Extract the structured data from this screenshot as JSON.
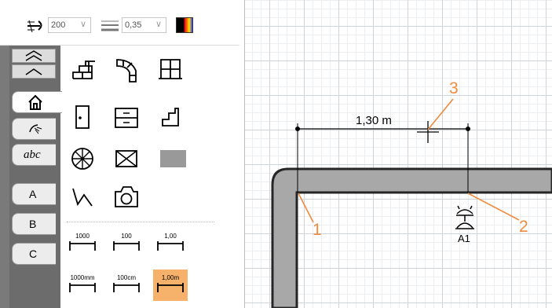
{
  "toolbar": {
    "line_weight_value": "200",
    "line_width_value": "0,35",
    "color_picker_icon": "color-picker-icon",
    "line_weight_icon": "line-weight-icon",
    "line_width_icon": "line-width-icon"
  },
  "sidebar": {
    "scroll_up_fast_icon": "double-chevron-up-icon",
    "scroll_up_icon": "chevron-up-icon",
    "tabs": [
      {
        "id": "home",
        "icon": "house-icon",
        "label": ""
      },
      {
        "id": "symbols",
        "icon": "shower-icon",
        "label": ""
      },
      {
        "id": "text",
        "icon": "text-abc-icon",
        "label": "abc"
      },
      {
        "id": "a",
        "label": "A"
      },
      {
        "id": "b",
        "label": "B"
      },
      {
        "id": "c",
        "label": "C"
      }
    ]
  },
  "palette": {
    "tools": [
      {
        "name": "wall-tool",
        "icon": "brick-wall-icon"
      },
      {
        "name": "curved-wall-tool",
        "icon": "curved-wall-icon"
      },
      {
        "name": "window-tool",
        "icon": "window-icon"
      },
      {
        "name": "door-tool",
        "icon": "door-icon"
      },
      {
        "name": "cabinet-tool",
        "icon": "cabinet-icon"
      },
      {
        "name": "stairs-tool",
        "icon": "stairs-icon"
      },
      {
        "name": "fan-tool",
        "icon": "fan-icon"
      },
      {
        "name": "box-tool",
        "icon": "crossed-box-icon"
      },
      {
        "name": "fill-tool",
        "icon": "gray-fill-icon"
      },
      {
        "name": "polyline-tool",
        "icon": "polyline-icon"
      },
      {
        "name": "camera-tool",
        "icon": "camera-icon"
      }
    ],
    "dimension_tools": [
      {
        "label": "1000",
        "selected": false
      },
      {
        "label": "100",
        "selected": false
      },
      {
        "label": "1,00",
        "selected": false
      },
      {
        "label": "1000mm",
        "selected": false
      },
      {
        "label": "100cm",
        "selected": false
      },
      {
        "label": "1,00m",
        "selected": true
      }
    ]
  },
  "drawing": {
    "dimension_text": "1,30 m",
    "point_labels": [
      "1",
      "2",
      "3"
    ],
    "symbol_label": "A1",
    "symbol_icon": "socket-icon",
    "crosshair_icon": "crosshair-cursor-icon",
    "annotation_color": "#f08a3c",
    "highlight_color": "#f6b26b"
  }
}
